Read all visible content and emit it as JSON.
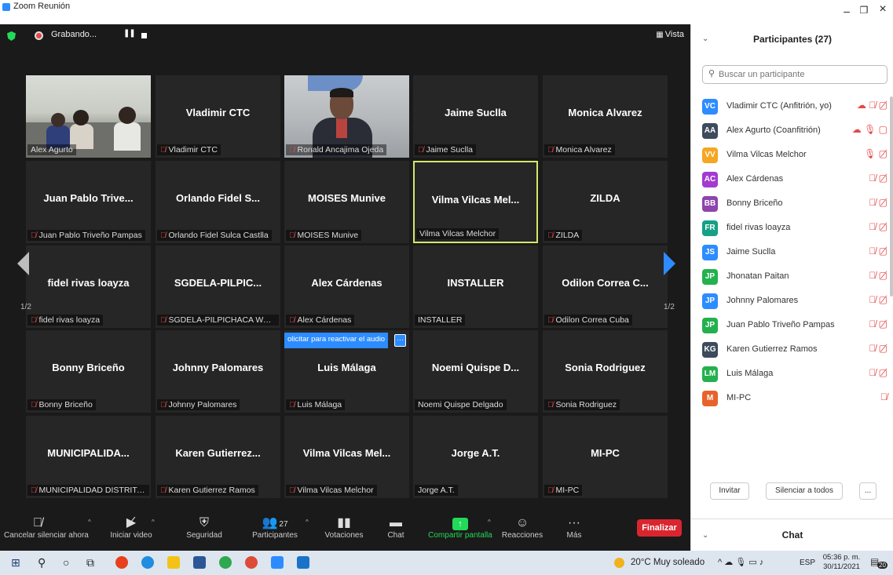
{
  "window": {
    "title": "Zoom Reunión",
    "minimize": "–",
    "maximize": "❐",
    "close": "×"
  },
  "topbar": {
    "recording_label": "Grabando...",
    "pause_glyph": "❚❚",
    "view_label": "Vista",
    "view_icon": "▦"
  },
  "tiles": [
    {
      "name": "",
      "label": "Alex Agurto",
      "muted": false,
      "video": "office"
    },
    {
      "name": "Vladimir CTC",
      "label": "Vladimir CTC",
      "muted": true
    },
    {
      "name": "",
      "label": "Ronald Ancajima Ojeda",
      "muted": true,
      "video": "man"
    },
    {
      "name": "Jaime Suclla",
      "label": "Jaime Suclla",
      "muted": true
    },
    {
      "name": "Monica Alvarez",
      "label": "Monica Alvarez",
      "muted": true
    },
    {
      "name": "Juan Pablo Trive...",
      "label": "Juan Pablo Triveño Pampas",
      "muted": true
    },
    {
      "name": "Orlando Fidel S...",
      "label": "Orlando Fidel Sulca Castlla",
      "muted": true
    },
    {
      "name": "MOISES Munive",
      "label": "MOISES Munive",
      "muted": true
    },
    {
      "name": "Vilma Vilcas Mel...",
      "label": "Vilma Vilcas Melchor",
      "muted": false,
      "active": true
    },
    {
      "name": "ZILDA",
      "label": "ZILDA",
      "muted": true
    },
    {
      "name": "fidel rivas loayza",
      "label": "fidel rivas loayza",
      "muted": true
    },
    {
      "name": "SGDELA-PILPIC...",
      "label": "SGDELA-PILPICHACA WALD...",
      "muted": true
    },
    {
      "name": "Alex Cárdenas",
      "label": "Alex Cárdenas",
      "muted": true
    },
    {
      "name": "INSTALLER",
      "label": "INSTALLER",
      "muted": false
    },
    {
      "name": "Odilon Correa C...",
      "label": "Odilon Correa Cuba",
      "muted": true
    },
    {
      "name": "Bonny Briceño",
      "label": "Bonny Briceño",
      "muted": true
    },
    {
      "name": "Johnny Palomares",
      "label": "Johnny Palomares",
      "muted": true
    },
    {
      "name": "Luis Málaga",
      "label": "Luis Málaga",
      "muted": true
    },
    {
      "name": "Noemi Quispe D...",
      "label": "Noemi Quispe Delgado",
      "muted": false
    },
    {
      "name": "Sonia Rodriguez",
      "label": "Sonia Rodriguez",
      "muted": true
    },
    {
      "name": "MUNICIPALIDA...",
      "label": "MUNICIPALIDAD DISTRITAL...",
      "muted": true
    },
    {
      "name": "Karen Gutierrez...",
      "label": "Karen Gutierrez Ramos",
      "muted": true
    },
    {
      "name": "Vilma Vilcas Mel...",
      "label": "Vilma Vilcas Melchor",
      "muted": true
    },
    {
      "name": "Jorge A.T.",
      "label": "Jorge A.T.",
      "muted": false
    },
    {
      "name": "MI-PC",
      "label": "MI-PC",
      "muted": true
    }
  ],
  "pager": {
    "left": "1/2",
    "right": "1/2"
  },
  "unmute_popup": {
    "text": "olicitar para reactivar el audio",
    "more": "···"
  },
  "toolbar": {
    "mute": "Cancelar silenciar ahora",
    "video": "Iniciar video",
    "security": "Seguridad",
    "participants": "Participantes",
    "participants_count": "27",
    "polls": "Votaciones",
    "chat": "Chat",
    "share": "Compartir pantalla",
    "reactions": "Reacciones",
    "more": "Más",
    "end": "Finalizar"
  },
  "panel": {
    "title": "Participantes (27)",
    "search_placeholder": "Buscar un participante",
    "participants": [
      {
        "initials": "VC",
        "name": "Vladimir CTC (Anfitrión, yo)",
        "color": "#2d8cff",
        "icons": "☁ 🎙̸ ▢̸"
      },
      {
        "initials": "AA",
        "name": "Alex Agurto (Coanfitrión)",
        "color": "#3d4b5c",
        "icons": "☁ 🎙 ▢"
      },
      {
        "initials": "VV",
        "name": "Vilma Vilcas Melchor",
        "color": "#f5a623",
        "icons": "🎙 ▢̸"
      },
      {
        "initials": "AC",
        "name": "Alex Cárdenas",
        "color": "#a33ad1",
        "icons": "🎙̸ ▢̸"
      },
      {
        "initials": "BB",
        "name": "Bonny Briceño",
        "color": "#8e44ad",
        "icons": "🎙̸ ▢̸"
      },
      {
        "initials": "FR",
        "name": "fidel rivas loayza",
        "color": "#16a085",
        "icons": "🎙̸ ▢̸"
      },
      {
        "initials": "JS",
        "name": "Jaime Suclla",
        "color": "#2d8cff",
        "icons": "🎙̸ ▢̸"
      },
      {
        "initials": "JP",
        "name": "Jhonatan Paitan",
        "color": "#23b14d",
        "icons": "🎙̸ ▢̸"
      },
      {
        "initials": "JP",
        "name": "Johnny Palomares",
        "color": "#2d8cff",
        "icons": "🎙̸ ▢̸"
      },
      {
        "initials": "JP",
        "name": "Juan Pablo Triveño Pampas",
        "color": "#23b14d",
        "icons": "🎙̸ ▢̸"
      },
      {
        "initials": "KG",
        "name": "Karen Gutierrez Ramos",
        "color": "#3d4b5c",
        "icons": "🎙̸ ▢̸"
      },
      {
        "initials": "LM",
        "name": "Luis Málaga",
        "color": "#23b14d",
        "icons": "🎙̸ ▢̸"
      },
      {
        "initials": "M",
        "name": "MI-PC",
        "color": "#e8632b",
        "icons": "🎙̸"
      }
    ],
    "invite": "Invitar",
    "mute_all": "Silenciar a todos",
    "more": "...",
    "chat_title": "Chat"
  },
  "taskbar": {
    "weather": "20°C  Muy soleado",
    "lang": "ESP",
    "time": "05:36 p. m.",
    "date": "30/11/2021",
    "notif_count": "20"
  }
}
